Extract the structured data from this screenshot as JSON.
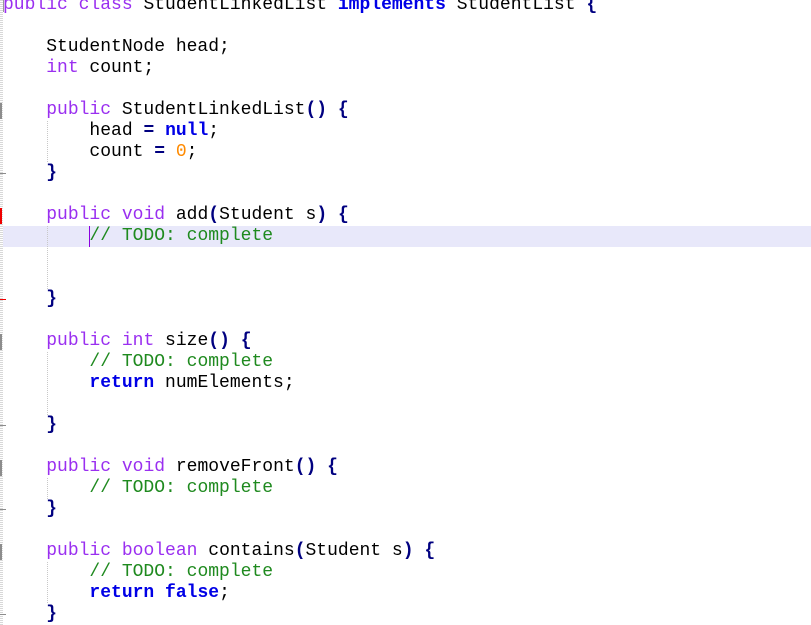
{
  "editor": {
    "language": "java",
    "colors": {
      "background": "#ffffff",
      "current_line": "#e8e8fa",
      "modifier": "#9a2ff0",
      "keyword": "#0000e6",
      "comment": "#1f8a1f",
      "number": "#ff8a00",
      "brace": "#000080",
      "caret": "#8b00e0",
      "marker_normal": "#8c8c8c",
      "marker_changed": "#ee0000"
    },
    "caret": {
      "line": 11,
      "column": 9
    },
    "current_line": 11,
    "lines": [
      [
        {
          "t": "mod",
          "v": "public"
        },
        {
          "t": "id",
          "v": " "
        },
        {
          "t": "mod",
          "v": "class"
        },
        {
          "t": "id",
          "v": " StudentLinkedList "
        },
        {
          "t": "kw",
          "v": "implements"
        },
        {
          "t": "id",
          "v": " StudentList "
        },
        {
          "t": "br",
          "v": "{"
        }
      ],
      [],
      [
        {
          "t": "id",
          "v": "    StudentNode head;"
        }
      ],
      [
        {
          "t": "id",
          "v": "    "
        },
        {
          "t": "mod",
          "v": "int"
        },
        {
          "t": "id",
          "v": " count;"
        }
      ],
      [],
      [
        {
          "t": "id",
          "v": "    "
        },
        {
          "t": "mod",
          "v": "public"
        },
        {
          "t": "id",
          "v": " StudentLinkedList"
        },
        {
          "t": "br",
          "v": "()"
        },
        {
          "t": "id",
          "v": " "
        },
        {
          "t": "br",
          "v": "{"
        }
      ],
      [
        {
          "t": "id",
          "v": "        head "
        },
        {
          "t": "op",
          "v": "="
        },
        {
          "t": "id",
          "v": " "
        },
        {
          "t": "kw",
          "v": "null"
        },
        {
          "t": "id",
          "v": ";"
        }
      ],
      [
        {
          "t": "id",
          "v": "        count "
        },
        {
          "t": "op",
          "v": "="
        },
        {
          "t": "id",
          "v": " "
        },
        {
          "t": "num",
          "v": "0"
        },
        {
          "t": "id",
          "v": ";"
        }
      ],
      [
        {
          "t": "id",
          "v": "    "
        },
        {
          "t": "br",
          "v": "}"
        }
      ],
      [],
      [
        {
          "t": "id",
          "v": "    "
        },
        {
          "t": "mod",
          "v": "public"
        },
        {
          "t": "id",
          "v": " "
        },
        {
          "t": "mod",
          "v": "void"
        },
        {
          "t": "id",
          "v": " add"
        },
        {
          "t": "br",
          "v": "("
        },
        {
          "t": "id",
          "v": "Student s"
        },
        {
          "t": "br",
          "v": ")"
        },
        {
          "t": "id",
          "v": " "
        },
        {
          "t": "br",
          "v": "{"
        }
      ],
      [
        {
          "t": "id",
          "v": "        "
        },
        {
          "t": "cm",
          "v": "// TODO: complete"
        }
      ],
      [],
      [],
      [
        {
          "t": "id",
          "v": "    "
        },
        {
          "t": "br",
          "v": "}"
        }
      ],
      [],
      [
        {
          "t": "id",
          "v": "    "
        },
        {
          "t": "mod",
          "v": "public"
        },
        {
          "t": "id",
          "v": " "
        },
        {
          "t": "mod",
          "v": "int"
        },
        {
          "t": "id",
          "v": " size"
        },
        {
          "t": "br",
          "v": "()"
        },
        {
          "t": "id",
          "v": " "
        },
        {
          "t": "br",
          "v": "{"
        }
      ],
      [
        {
          "t": "id",
          "v": "        "
        },
        {
          "t": "cm",
          "v": "// TODO: complete"
        }
      ],
      [
        {
          "t": "id",
          "v": "        "
        },
        {
          "t": "kw",
          "v": "return"
        },
        {
          "t": "id",
          "v": " numElements;"
        }
      ],
      [],
      [
        {
          "t": "id",
          "v": "    "
        },
        {
          "t": "br",
          "v": "}"
        }
      ],
      [],
      [
        {
          "t": "id",
          "v": "    "
        },
        {
          "t": "mod",
          "v": "public"
        },
        {
          "t": "id",
          "v": " "
        },
        {
          "t": "mod",
          "v": "void"
        },
        {
          "t": "id",
          "v": " removeFront"
        },
        {
          "t": "br",
          "v": "()"
        },
        {
          "t": "id",
          "v": " "
        },
        {
          "t": "br",
          "v": "{"
        }
      ],
      [
        {
          "t": "id",
          "v": "        "
        },
        {
          "t": "cm",
          "v": "// TODO: complete"
        }
      ],
      [
        {
          "t": "id",
          "v": "    "
        },
        {
          "t": "br",
          "v": "}"
        }
      ],
      [],
      [
        {
          "t": "id",
          "v": "    "
        },
        {
          "t": "mod",
          "v": "public"
        },
        {
          "t": "id",
          "v": " "
        },
        {
          "t": "mod",
          "v": "boolean"
        },
        {
          "t": "id",
          "v": " contains"
        },
        {
          "t": "br",
          "v": "("
        },
        {
          "t": "id",
          "v": "Student s"
        },
        {
          "t": "br",
          "v": ")"
        },
        {
          "t": "id",
          "v": " "
        },
        {
          "t": "br",
          "v": "{"
        }
      ],
      [
        {
          "t": "id",
          "v": "        "
        },
        {
          "t": "cm",
          "v": "// TODO: complete"
        }
      ],
      [
        {
          "t": "id",
          "v": "        "
        },
        {
          "t": "kw",
          "v": "return"
        },
        {
          "t": "id",
          "v": " "
        },
        {
          "t": "kw",
          "v": "false"
        },
        {
          "t": "id",
          "v": ";"
        }
      ],
      [
        {
          "t": "id",
          "v": "    "
        },
        {
          "t": "br",
          "v": "}"
        }
      ]
    ],
    "gutter_markers": [
      {
        "start": 5,
        "end": 8,
        "state": "normal"
      },
      {
        "start": 10,
        "end": 14,
        "state": "changed"
      },
      {
        "start": 16,
        "end": 20,
        "state": "normal"
      },
      {
        "start": 22,
        "end": 24,
        "state": "normal"
      },
      {
        "start": 26,
        "end": 29,
        "state": "normal"
      }
    ]
  }
}
